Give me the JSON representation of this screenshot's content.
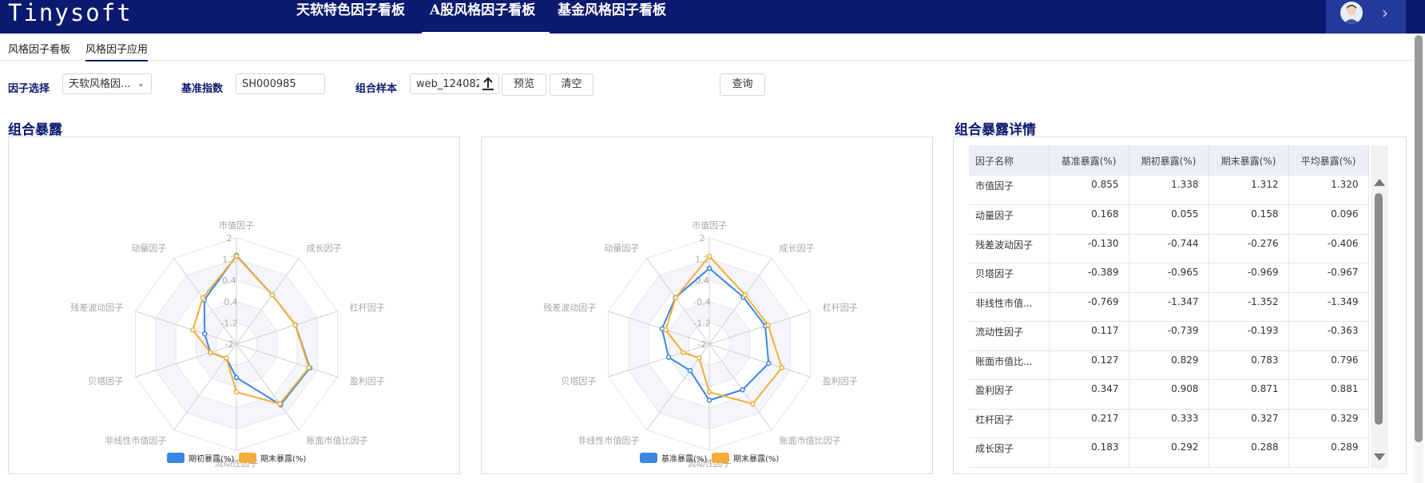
{
  "app": {
    "logo": "Tinysoft",
    "nav_tabs": [
      "天软特色因子看板",
      "A股风格因子看板",
      "基金风格因子看板"
    ],
    "active_nav": "A股风格因子看板"
  },
  "subtabs": [
    "风格因子看板",
    "风格因子应用"
  ],
  "active_subtab": "风格因子应用",
  "filters": {
    "factor_label": "因子选择",
    "factor_value": "天软风格因...",
    "benchmark_label": "基准指数",
    "benchmark_value": "SH000985",
    "sample_label": "组合样本",
    "sample_value": "web_124082!",
    "preview_label": "预览",
    "clear_label": "清空",
    "query_label": "查询"
  },
  "sections": {
    "exposure_title": "组合暴露",
    "detail_title": "组合暴露详情"
  },
  "chart_data": [
    {
      "type": "radar",
      "indicators": [
        "市值因子",
        "成长因子",
        "杠杆因子",
        "盈利因子",
        "账面市值比因子",
        "流动性因子",
        "非线性市值因子",
        "贝塔因子",
        "残差波动因子",
        "动量因子"
      ],
      "ticks": [
        "2",
        "1.2",
        "0.4",
        "-0.4",
        "-1.2",
        "-2"
      ],
      "range": [
        -2,
        2
      ],
      "series": [
        {
          "name": "期初暴露(%)",
          "color": "#3a86e0",
          "values": [
            1.338,
            0.292,
            0.333,
            0.908,
            0.829,
            -0.739,
            -1.347,
            -0.965,
            -0.744,
            0.055
          ]
        },
        {
          "name": "期末暴露(%)",
          "color": "#f5ad3a",
          "values": [
            1.312,
            0.288,
            0.327,
            0.871,
            0.783,
            -0.193,
            -1.352,
            -0.969,
            -0.276,
            0.158
          ]
        }
      ]
    },
    {
      "type": "radar",
      "indicators": [
        "市值因子",
        "成长因子",
        "杠杆因子",
        "盈利因子",
        "账面市值比因子",
        "流动性因子",
        "非线性市值因子",
        "贝塔因子",
        "残差波动因子",
        "动量因子"
      ],
      "ticks": [
        "2",
        "1.2",
        "0.4",
        "-0.4",
        "-1.2",
        "-2"
      ],
      "range": [
        -2,
        2
      ],
      "series": [
        {
          "name": "基准暴露(%)",
          "color": "#3a86e0",
          "values": [
            0.855,
            0.183,
            0.217,
            0.347,
            0.127,
            0.117,
            -0.769,
            -0.389,
            -0.13,
            0.168
          ]
        },
        {
          "name": "期末暴露(%)",
          "color": "#f5ad3a",
          "values": [
            1.312,
            0.288,
            0.327,
            0.871,
            0.783,
            -0.193,
            -1.352,
            -0.969,
            -0.276,
            0.158
          ]
        }
      ]
    }
  ],
  "table": {
    "headers": [
      "因子名称",
      "基准暴露(%)",
      "期初暴露(%)",
      "期末暴露(%)",
      "平均暴露(%)"
    ],
    "rows": [
      [
        "市值因子",
        "0.855",
        "1.338",
        "1.312",
        "1.320"
      ],
      [
        "动量因子",
        "0.168",
        "0.055",
        "0.158",
        "0.096"
      ],
      [
        "残差波动因子",
        "-0.130",
        "-0.744",
        "-0.276",
        "-0.406"
      ],
      [
        "贝塔因子",
        "-0.389",
        "-0.965",
        "-0.969",
        "-0.967"
      ],
      [
        "非线性市值...",
        "-0.769",
        "-1.347",
        "-1.352",
        "-1.349"
      ],
      [
        "流动性因子",
        "0.117",
        "-0.739",
        "-0.193",
        "-0.363"
      ],
      [
        "账面市值比...",
        "0.127",
        "0.829",
        "0.783",
        "0.796"
      ],
      [
        "盈利因子",
        "0.347",
        "0.908",
        "0.871",
        "0.881"
      ],
      [
        "杠杆因子",
        "0.217",
        "0.333",
        "0.327",
        "0.329"
      ],
      [
        "成长因子",
        "0.183",
        "0.292",
        "0.288",
        "0.289"
      ]
    ]
  }
}
